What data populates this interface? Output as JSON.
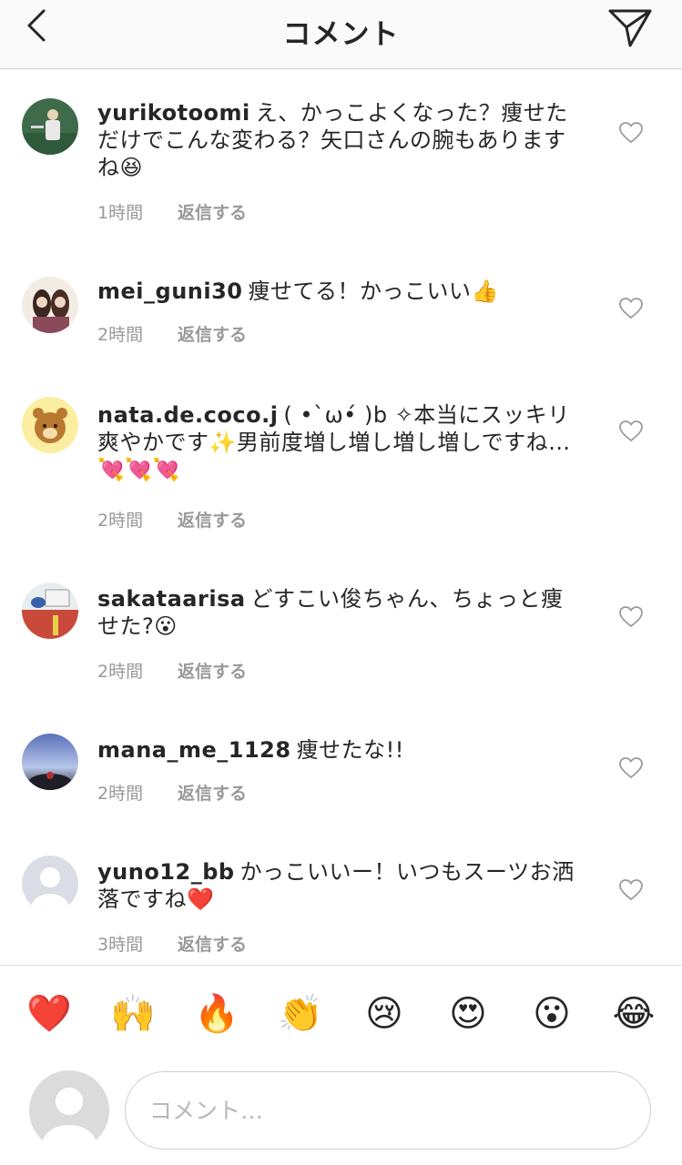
{
  "header": {
    "title": "コメント"
  },
  "comments": [
    {
      "username": "yurikotoomi",
      "text": "え、かっこよくなった？痩せただけでこんな変わる？矢口さんの腕もありますね😆",
      "time": "1時間",
      "reply": "返信する",
      "avatar": "photo-baseball"
    },
    {
      "username": "mei_guni30",
      "text": "痩せてる！かっこいい👍",
      "time": "2時間",
      "reply": "返信する",
      "avatar": "photo-two-girls"
    },
    {
      "username": "nata.de.coco.j",
      "text": "( •`ω•́ )b ✧本当にスッキリ爽やかです✨男前度増し増し増し増しですね…💘💘💘",
      "time": "2時間",
      "reply": "返信する",
      "avatar": "rilakkuma"
    },
    {
      "username": "sakataarisa",
      "text": "どすこい俊ちゃん、ちょっと痩せた?😮",
      "time": "2時間",
      "reply": "返信する",
      "avatar": "illustration"
    },
    {
      "username": "mana_me_1128",
      "text": "痩せたな!!",
      "time": "2時間",
      "reply": "返信する",
      "avatar": "photo-sky"
    },
    {
      "username": "yuno12_bb",
      "text": "かっこいいー！いつもスーツお洒落ですね❤️",
      "time": "3時間",
      "reply": "返信する",
      "avatar": "default"
    }
  ],
  "quick_emojis": [
    "❤️",
    "🙌",
    "🔥",
    "👏",
    "😢",
    "😍",
    "😮",
    "😂"
  ],
  "composer": {
    "placeholder": "コメント…"
  },
  "colors": {
    "text": "#262626",
    "meta": "#999999",
    "header_bg": "#fafafa"
  }
}
